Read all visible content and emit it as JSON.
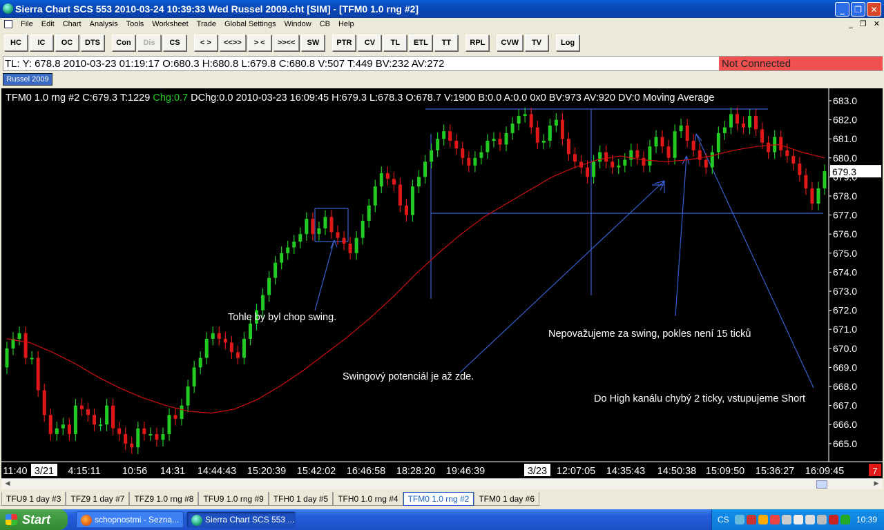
{
  "window": {
    "title": "Sierra Chart SCS 553  2010-03-24  10:39:33  Wed   Russel 2009.cht [SIM] - [TFM0  1.0 rng  #2]",
    "controls": [
      "_",
      "❐",
      "✕"
    ]
  },
  "menu": {
    "items": [
      "File",
      "Edit",
      "Chart",
      "Analysis",
      "Tools",
      "Worksheet",
      "Trade",
      "Global Settings",
      "Window",
      "CB",
      "Help"
    ],
    "mdi_controls": [
      "_",
      "❐",
      "✕"
    ]
  },
  "toolbar": {
    "groups": [
      [
        "HC",
        "IC",
        "OC",
        "DTS"
      ],
      [
        "Con",
        "Dis",
        "CS"
      ],
      [
        "< >",
        "<<>>",
        "> <",
        ">><<",
        "SW"
      ],
      [
        "PTR",
        "CV",
        "TL",
        "ETL",
        "TT"
      ],
      [
        "RPL"
      ],
      [
        "CVW",
        "TV"
      ],
      [
        "Log"
      ]
    ],
    "disabled": [
      "Dis"
    ]
  },
  "status_line": {
    "text": "TL: Y: 678.8  2010-03-23  01:19:17  O:680.3  H:680.8  L:679.8  C:680.8  V:507  T:449  BV:232  AV:272",
    "connection": "Not Connected",
    "connection_color": "#f05050"
  },
  "chart_tab": "Russel 2009",
  "chart": {
    "header": {
      "prefix": "TFM0  1.0 rng  #2  C:679.3  T:1229  ",
      "chg": "Chg:0.7",
      "suffix": "  DChg:0.0  2010-03-23  16:09:45  H:679.3  L:678.3  O:678.7  V:1900  B:0.0  A:0.0  0x0   BV:973  AV:920  DV:0  Moving Average"
    },
    "last_price": "679.3",
    "last_price_value": 679.3,
    "y_ticks": [
      "683.0",
      "682.0",
      "681.0",
      "680.0",
      "679.0",
      "678.0",
      "677.0",
      "676.0",
      "675.0",
      "674.0",
      "673.0",
      "672.0",
      "671.0",
      "670.0",
      "669.0",
      "668.0",
      "667.0",
      "666.0",
      "665.0"
    ],
    "x_labels": [
      "11:40",
      "3/21",
      "4:15:11",
      "10:56",
      "14:31",
      "14:44:43",
      "15:20:39",
      "15:42:02",
      "16:46:58",
      "18:28:20",
      "19:46:39",
      "3/23",
      "12:07:05",
      "14:35:43",
      "14:50:38",
      "15:09:50",
      "15:36:27",
      "16:09:45"
    ],
    "x_highlight": [
      "3/21",
      "3/23"
    ],
    "corner_badge": "7",
    "annotations": [
      "Tohle by byl chop swing.",
      "Swingový potenciál je až zde.",
      "Nepovažujeme za swing, pokles není 15 ticků",
      "Do High kanálu chybý 2 ticky, vstupujeme Short"
    ],
    "colors": {
      "up": "#22cc22",
      "down": "#e01818",
      "ma": "#d01010",
      "line": "#3a5fd0",
      "axis": "#ffffff"
    }
  },
  "chart_data": {
    "type": "candlestick",
    "ylim": [
      664.5,
      683.5
    ],
    "open": [
      669.0,
      670.0,
      670.5,
      670.8,
      669.5,
      669.5,
      667.8,
      666.5,
      665.5,
      665.8,
      666.0,
      665.5,
      667.0,
      666.8,
      666.5,
      666.0,
      666.0,
      667.0,
      665.8,
      665.5,
      665.0,
      664.8,
      665.8,
      665.5,
      665.5,
      665.2,
      665.5,
      666.5,
      666.3,
      667.0,
      668.0,
      669.0,
      669.5,
      670.5,
      670.8,
      670.5,
      670.3,
      669.8,
      669.5,
      670.5,
      671.3,
      672.0,
      672.8,
      673.7,
      674.5,
      675.0,
      675.3,
      675.6,
      676.0,
      676.8,
      676.0,
      676.3,
      676.9,
      676.1,
      675.8,
      675.5,
      675.0,
      675.8,
      676.7,
      677.5,
      678.5,
      679.2,
      678.9,
      678.6,
      677.5,
      677.0,
      678.5,
      679.0,
      679.8,
      680.4,
      681.0,
      681.4,
      680.9,
      680.5,
      680.0,
      679.6,
      680.0,
      680.3,
      680.9,
      681.0,
      680.7,
      681.3,
      681.8,
      682.2,
      682.3,
      681.6,
      680.8,
      680.9,
      681.7,
      682.0,
      681.0,
      680.2,
      679.8,
      679.5,
      679.0,
      679.8,
      680.3,
      679.8,
      679.5,
      679.6,
      679.9,
      680.4,
      680.0,
      679.6,
      680.6,
      681.1,
      680.6,
      680.0,
      681.4,
      681.7,
      680.9,
      680.4,
      679.9,
      679.5,
      680.3,
      681.3,
      681.6,
      682.3,
      681.8,
      681.6,
      682.2,
      681.5,
      680.8,
      680.3,
      681.1,
      680.4,
      680.1,
      679.7,
      679.1,
      678.4,
      677.6,
      678.4
    ],
    "close": [
      670.0,
      670.5,
      670.8,
      669.5,
      669.5,
      667.8,
      666.5,
      665.5,
      665.8,
      666.0,
      665.5,
      667.0,
      666.8,
      666.5,
      666.0,
      666.0,
      667.0,
      665.8,
      665.5,
      665.0,
      664.8,
      665.8,
      665.5,
      665.5,
      665.2,
      665.5,
      666.5,
      666.3,
      667.0,
      668.0,
      669.0,
      669.5,
      670.5,
      670.8,
      670.5,
      670.3,
      669.8,
      669.5,
      670.5,
      671.3,
      672.0,
      672.8,
      673.7,
      674.5,
      675.0,
      675.3,
      675.6,
      676.0,
      676.8,
      676.0,
      676.3,
      676.9,
      676.1,
      675.8,
      675.5,
      675.0,
      675.8,
      676.7,
      677.5,
      678.5,
      679.2,
      678.9,
      678.6,
      677.5,
      677.0,
      678.5,
      679.0,
      679.8,
      680.4,
      681.0,
      681.4,
      680.9,
      680.5,
      680.0,
      679.6,
      680.0,
      680.3,
      680.9,
      681.0,
      680.7,
      681.3,
      681.8,
      682.2,
      682.3,
      681.6,
      680.8,
      680.9,
      681.7,
      682.0,
      681.0,
      680.2,
      679.8,
      679.5,
      679.0,
      679.8,
      680.3,
      679.8,
      679.5,
      679.6,
      679.9,
      680.4,
      680.0,
      679.6,
      680.6,
      681.1,
      680.6,
      680.0,
      681.4,
      681.7,
      680.9,
      680.4,
      679.9,
      679.5,
      680.3,
      681.3,
      681.6,
      682.3,
      681.8,
      681.6,
      682.2,
      681.5,
      680.8,
      680.3,
      681.1,
      680.4,
      680.1,
      679.7,
      679.1,
      678.4,
      677.6,
      678.4,
      679.3
    ],
    "moving_average": [
      670.5,
      670.3,
      669.8,
      669.2,
      668.5,
      667.9,
      667.4,
      667.0,
      666.7,
      666.6,
      666.8,
      667.3,
      668.0,
      668.8,
      669.7,
      670.6,
      671.6,
      672.7,
      673.9,
      675.0,
      676.0,
      676.9,
      677.6,
      678.3,
      679.0,
      679.5,
      679.9,
      680.1,
      679.9,
      679.8,
      679.9,
      680.1,
      680.4,
      680.6,
      680.7,
      680.3,
      680.0
    ],
    "x": [
      "11:40",
      "3/21",
      "4:15:11",
      "10:56",
      "14:31",
      "14:44:43",
      "15:20:39",
      "15:42:02",
      "16:46:58",
      "18:28:20",
      "19:46:39",
      "3/23",
      "12:07:05",
      "14:35:43",
      "14:50:38",
      "15:09:50",
      "15:36:27",
      "16:09:45"
    ],
    "series": [
      {
        "name": "TFM0  1.0 rng  #2"
      },
      {
        "name": "Moving Average"
      }
    ]
  },
  "bottom_tabs": [
    "TFU9  1 day  #3",
    "TFZ9  1 day  #7",
    "TFZ9  1.0 rng  #8",
    "TFU9  1.0 rng  #9",
    "TFH0  1 day  #5",
    "TFH0  1.0 rng  #4",
    "TFM0  1.0 rng  #2",
    "TFM0  1 day  #6"
  ],
  "active_tab": "TFM0  1.0 rng  #2",
  "taskbar": {
    "start": "Start",
    "tasks": [
      "schopnostmi - Sezna...",
      "Sierra Chart SCS 553 ..."
    ],
    "lang": "CS",
    "clock": "10:39"
  }
}
